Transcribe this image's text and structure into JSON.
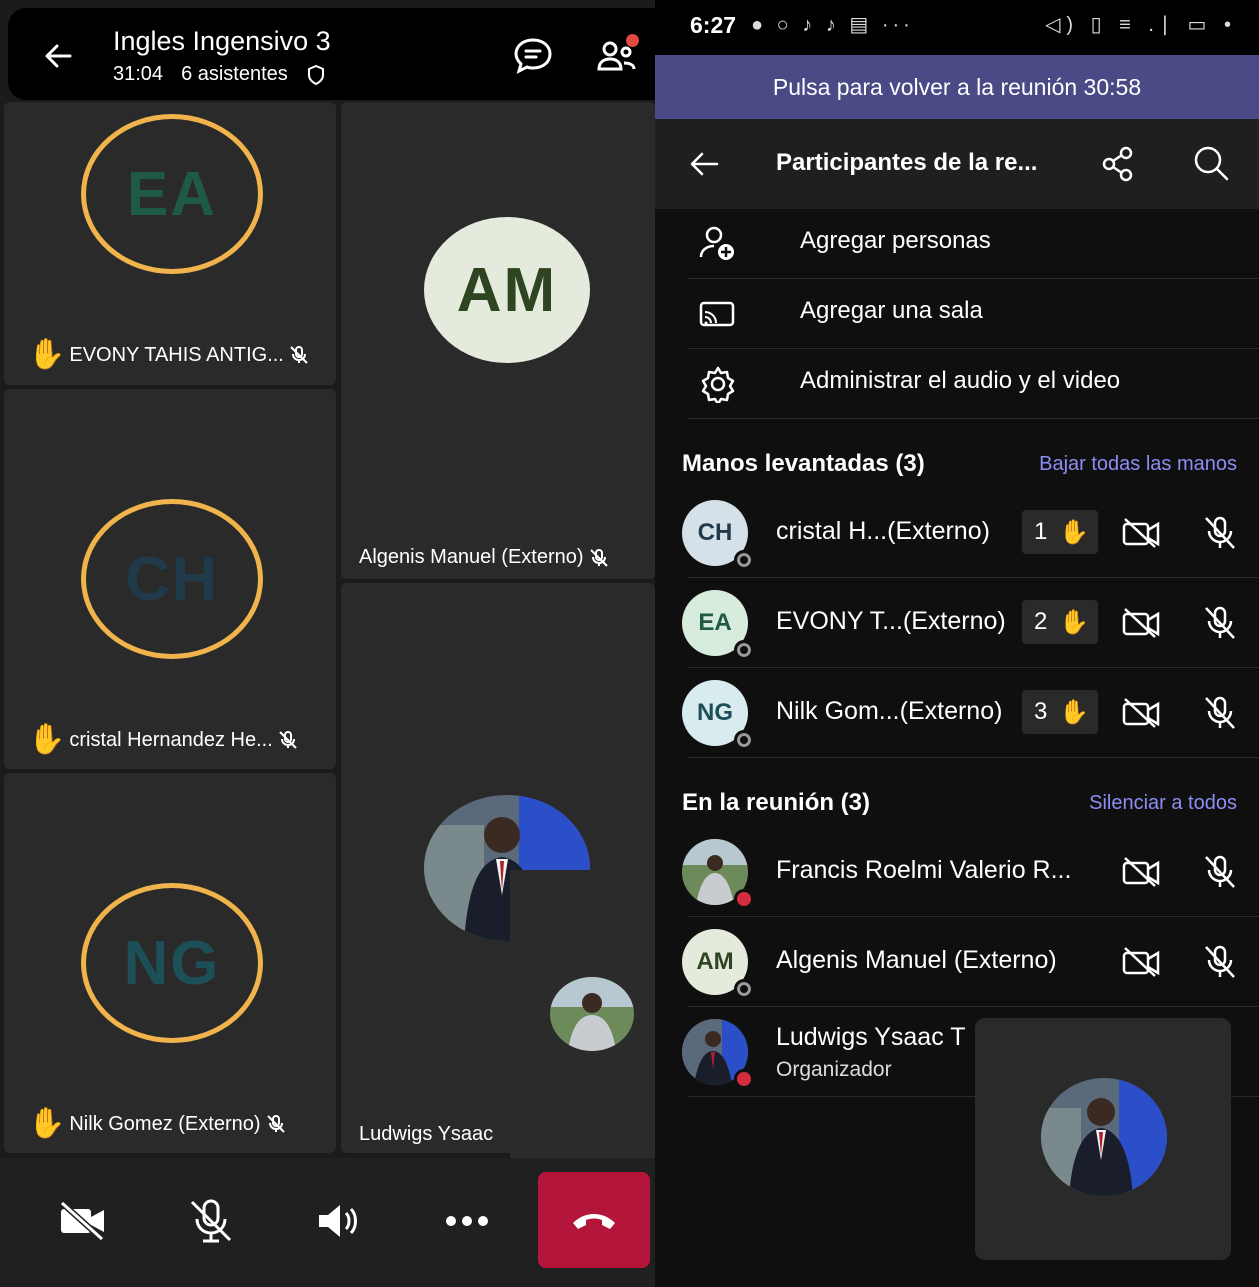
{
  "meeting": {
    "title": "Ingles Ingensivo 3",
    "duration": "31:04",
    "attendees": "6 asistentes",
    "tiles": [
      {
        "initials": "EA",
        "name": "EVONY TAHIS ANTIG...",
        "bg": "#d8ecde",
        "fg": "#1e5a44"
      },
      {
        "initials": "AM",
        "name": "Algenis Manuel (Externo)",
        "bg": "#e4ebdc",
        "fg": "#2f4420"
      },
      {
        "initials": "CH",
        "name": "cristal Hernandez He...",
        "bg": "#d5e1e8",
        "fg": "#203a4a"
      },
      {
        "initials": "NG",
        "name": "Nilk Gomez (Externo)",
        "bg": "#d8ecf0",
        "fg": "#1d4f58"
      },
      {
        "name": "Ludwigs Ysaac"
      }
    ]
  },
  "status_bar": {
    "time": "6:27",
    "icons_left": "● ○ ♪ ♪ ▤ ···",
    "icons_right": "◁) ▯ ≡ .∣ ▭ •"
  },
  "banner": "Pulsa para volver a la reunión 30:58",
  "participants_panel": {
    "title": "Participantes de la re...",
    "actions": [
      {
        "label": "Agregar personas",
        "icon": "add-person-icon"
      },
      {
        "label": "Agregar una sala",
        "icon": "cast-room-icon"
      },
      {
        "label": "Administrar el audio y el video",
        "icon": "gear-icon"
      }
    ],
    "raised_hands": {
      "header": "Manos levantadas (3)",
      "action": "Bajar todas las manos",
      "people": [
        {
          "initials": "CH",
          "name": "cristal H...(Externo)",
          "order": "1",
          "bg": "#d5e1e8",
          "fg": "#203a4a"
        },
        {
          "initials": "EA",
          "name": "EVONY T...(Externo)",
          "order": "2",
          "bg": "#d8ecde",
          "fg": "#1e5a44"
        },
        {
          "initials": "NG",
          "name": "Nilk Gom...(Externo)",
          "order": "3",
          "bg": "#d8ecf0",
          "fg": "#1d4f58"
        }
      ]
    },
    "in_meeting": {
      "header": "En la reunión (3)",
      "action": "Silenciar a todos",
      "people": [
        {
          "name": "Francis Roelmi Valerio R..."
        },
        {
          "initials": "AM",
          "name": "Algenis Manuel (Externo)",
          "bg": "#e4ebdc",
          "fg": "#2f4420"
        },
        {
          "name": "Ludwigs Ysaac T",
          "role": "Organizador"
        }
      ]
    }
  }
}
